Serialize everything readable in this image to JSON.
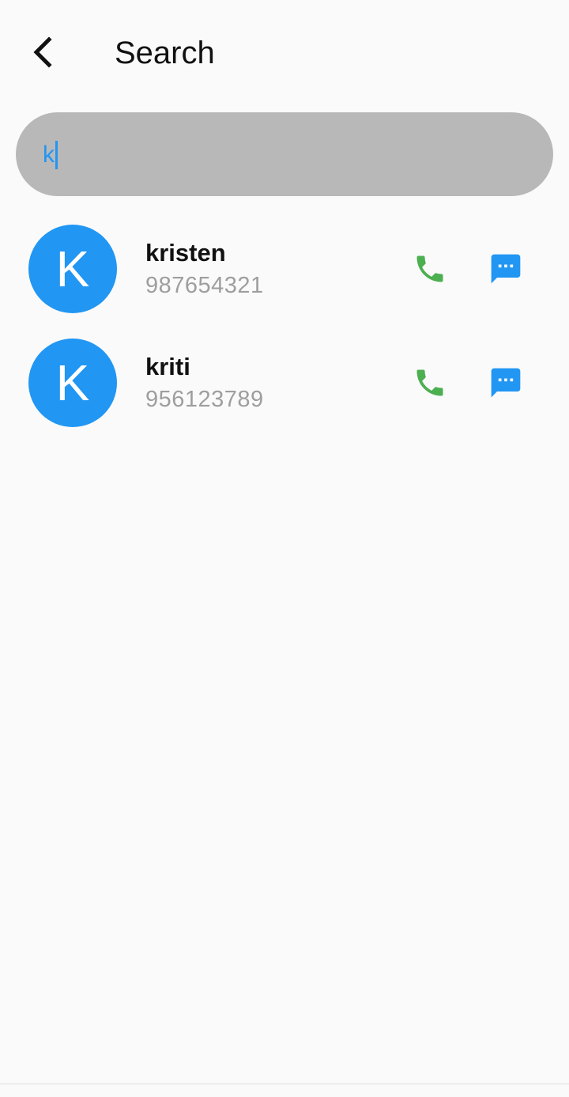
{
  "app_bar": {
    "title": "Search",
    "back_icon": "chevron-left-icon"
  },
  "search": {
    "value": "k",
    "placeholder": ""
  },
  "contacts": [
    {
      "initial": "K",
      "name": "kristen",
      "phone": "987654321"
    },
    {
      "initial": "K",
      "name": "kriti",
      "phone": "956123789"
    }
  ],
  "icons": {
    "call": "phone-icon",
    "message": "message-icon"
  },
  "colors": {
    "accent": "#2196f3",
    "call": "#4caf50",
    "search_bg": "#b8b8b8",
    "background": "#fafafa",
    "secondary_text": "#9e9e9e"
  }
}
